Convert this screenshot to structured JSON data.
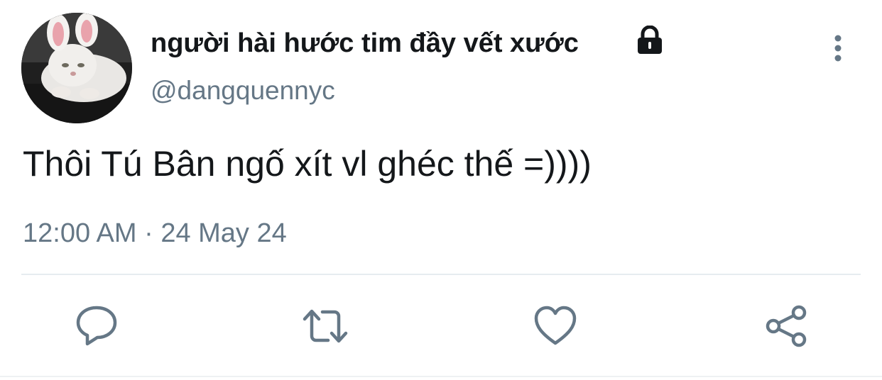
{
  "tweet": {
    "display_name": "người hài hước tim đầy vết xước",
    "handle": "@dangquennyc",
    "text": "Thôi Tú Bân ngố xít vl ghéc thế =))))",
    "timestamp": "12:00 AM · 24 May 24"
  },
  "icons": {
    "protected": "lock-icon",
    "menu": "more-vertical-icon",
    "reply": "reply-icon",
    "retweet": "retweet-icon",
    "like": "heart-icon",
    "share": "share-icon"
  },
  "colors": {
    "text": "#14171a",
    "secondary": "#657786",
    "divider": "#e6ecf0"
  }
}
